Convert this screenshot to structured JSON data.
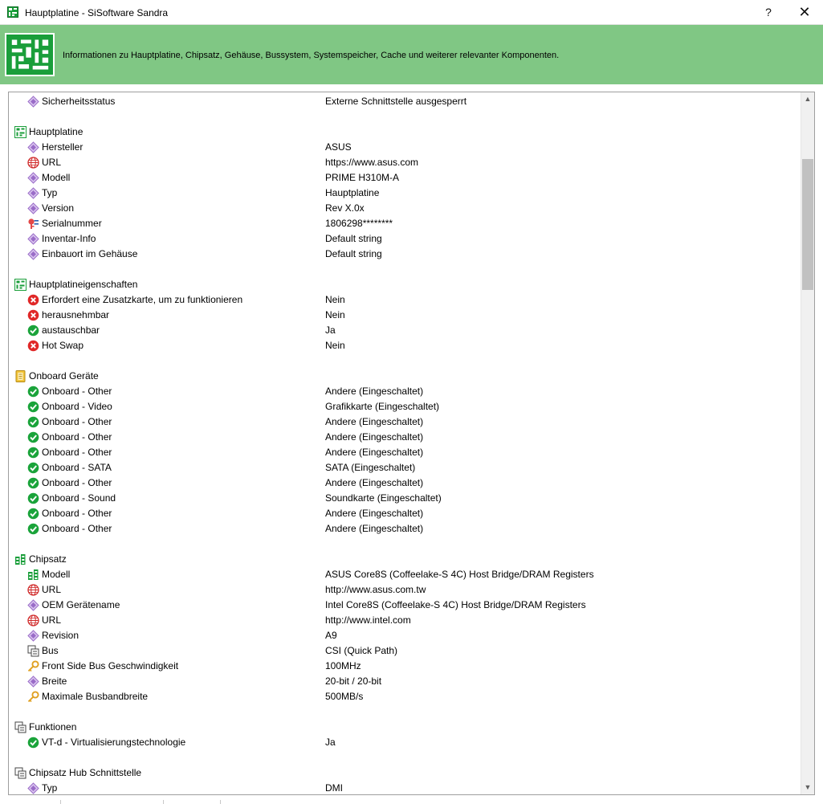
{
  "window": {
    "title": "Hauptplatine - SiSoftware Sandra",
    "help_label": "?",
    "close_label": "✕"
  },
  "banner": {
    "description": "Informationen zu Hauptplatine, Chipsatz, Gehäuse, Bussystem, Systemspeicher, Cache und weiterer relevanter Komponenten."
  },
  "colors": {
    "banner_green": "#80c784",
    "logo_green": "#1a9e3a",
    "ok_green": "#1aa33a",
    "error_red": "#e02828",
    "property_purple": "#9a6cc8",
    "key_orange": "#e0a020"
  },
  "rows": [
    {
      "kind": "item",
      "icon": "property-icon",
      "label": "Sicherheitsstatus",
      "value": "Externe Schnittstelle ausgesperrt"
    },
    {
      "kind": "spacer"
    },
    {
      "kind": "header",
      "icon": "board-icon",
      "label": "Hauptplatine"
    },
    {
      "kind": "item",
      "icon": "property-icon",
      "label": "Hersteller",
      "value": "ASUS"
    },
    {
      "kind": "item",
      "icon": "globe-icon",
      "label": "URL",
      "value": "https://www.asus.com"
    },
    {
      "kind": "item",
      "icon": "property-icon",
      "label": "Modell",
      "value": "PRIME H310M-A"
    },
    {
      "kind": "item",
      "icon": "property-icon",
      "label": "Typ",
      "value": "Hauptplatine"
    },
    {
      "kind": "item",
      "icon": "property-icon",
      "label": "Version",
      "value": "Rev X.0x"
    },
    {
      "kind": "item",
      "icon": "serial-icon",
      "label": "Serialnummer",
      "value": "1806298********"
    },
    {
      "kind": "item",
      "icon": "property-icon",
      "label": "Inventar-Info",
      "value": "Default string"
    },
    {
      "kind": "item",
      "icon": "property-icon",
      "label": "Einbauort im Gehäuse",
      "value": "Default string"
    },
    {
      "kind": "spacer"
    },
    {
      "kind": "header",
      "icon": "board-icon",
      "label": "Hauptplatineigenschaften"
    },
    {
      "kind": "item",
      "icon": "error-icon",
      "label": "Erfordert eine Zusatzkarte, um zu funktionieren",
      "value": "Nein"
    },
    {
      "kind": "item",
      "icon": "error-icon",
      "label": "herausnehmbar",
      "value": "Nein"
    },
    {
      "kind": "item",
      "icon": "check-icon",
      "label": "austauschbar",
      "value": "Ja"
    },
    {
      "kind": "item",
      "icon": "error-icon",
      "label": "Hot Swap",
      "value": "Nein"
    },
    {
      "kind": "spacer"
    },
    {
      "kind": "header",
      "icon": "device-icon",
      "label": "Onboard Geräte"
    },
    {
      "kind": "item",
      "icon": "check-icon",
      "label": "Onboard - Other",
      "value": "Andere (Eingeschaltet)"
    },
    {
      "kind": "item",
      "icon": "check-icon",
      "label": "Onboard - Video",
      "value": "Grafikkarte (Eingeschaltet)"
    },
    {
      "kind": "item",
      "icon": "check-icon",
      "label": "Onboard - Other",
      "value": "Andere (Eingeschaltet)"
    },
    {
      "kind": "item",
      "icon": "check-icon",
      "label": "Onboard - Other",
      "value": "Andere (Eingeschaltet)"
    },
    {
      "kind": "item",
      "icon": "check-icon",
      "label": "Onboard - Other",
      "value": "Andere (Eingeschaltet)"
    },
    {
      "kind": "item",
      "icon": "check-icon",
      "label": "Onboard - SATA",
      "value": "SATA (Eingeschaltet)"
    },
    {
      "kind": "item",
      "icon": "check-icon",
      "label": "Onboard - Other",
      "value": "Andere (Eingeschaltet)"
    },
    {
      "kind": "item",
      "icon": "check-icon",
      "label": "Onboard - Sound",
      "value": "Soundkarte (Eingeschaltet)"
    },
    {
      "kind": "item",
      "icon": "check-icon",
      "label": "Onboard - Other",
      "value": "Andere (Eingeschaltet)"
    },
    {
      "kind": "item",
      "icon": "check-icon",
      "label": "Onboard - Other",
      "value": "Andere (Eingeschaltet)"
    },
    {
      "kind": "spacer"
    },
    {
      "kind": "header",
      "icon": "chipset-icon",
      "label": "Chipsatz"
    },
    {
      "kind": "item",
      "icon": "chipset-icon",
      "label": "Modell",
      "value": "ASUS Core8S (Coffeelake-S 4C) Host Bridge/DRAM Registers"
    },
    {
      "kind": "item",
      "icon": "globe-icon",
      "label": "URL",
      "value": "http://www.asus.com.tw"
    },
    {
      "kind": "item",
      "icon": "property-icon",
      "label": "OEM Gerätename",
      "value": "Intel Core8S (Coffeelake-S 4C) Host Bridge/DRAM Registers"
    },
    {
      "kind": "item",
      "icon": "globe-icon",
      "label": "URL",
      "value": "http://www.intel.com"
    },
    {
      "kind": "item",
      "icon": "property-icon",
      "label": "Revision",
      "value": "A9"
    },
    {
      "kind": "item",
      "icon": "bus-icon",
      "label": "Bus",
      "value": "CSI (Quick Path)"
    },
    {
      "kind": "item",
      "icon": "key-icon",
      "label": "Front Side Bus Geschwindigkeit",
      "value": "100MHz"
    },
    {
      "kind": "item",
      "icon": "property-icon",
      "label": "Breite",
      "value": "20-bit / 20-bit"
    },
    {
      "kind": "item",
      "icon": "key-icon",
      "label": "Maximale Busbandbreite",
      "value": "500MB/s"
    },
    {
      "kind": "spacer"
    },
    {
      "kind": "header",
      "icon": "bus-icon",
      "label": "Funktionen"
    },
    {
      "kind": "item",
      "icon": "check-icon",
      "label": "VT-d - Virtualisierungstechnologie",
      "value": "Ja"
    },
    {
      "kind": "spacer"
    },
    {
      "kind": "header",
      "icon": "bus-icon",
      "label": "Chipsatz Hub Schnittstelle"
    },
    {
      "kind": "item",
      "icon": "property-icon",
      "label": "Typ",
      "value": "DMI"
    }
  ],
  "scrollbar": {
    "up_glyph": "▲",
    "down_glyph": "▼"
  }
}
